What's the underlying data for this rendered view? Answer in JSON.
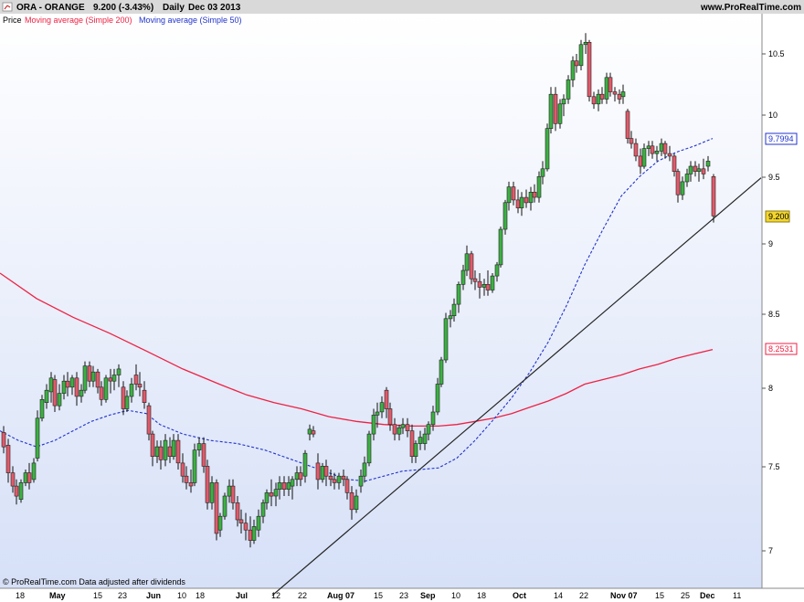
{
  "header": {
    "symbol": "ORA - ORANGE",
    "quote": "9.200 (-3.43%)",
    "period": "Daily",
    "date": "Dec 03 2013",
    "site": "www.ProRealTime.com",
    "legend_price": "Price",
    "legend_ma200": "Moving average (Simple 200)",
    "legend_ma50": "Moving average (Simple 50)"
  },
  "footer": {
    "note": "© ProRealTime.com  Data adjusted after dividends"
  },
  "colors": {
    "up": "#3cb043",
    "down": "#e05a6a",
    "ma200": "#ee2244",
    "ma50": "#2233cc",
    "trendline": "#222222",
    "bg_top": "#ffffff",
    "bg_bottom": "#d6e0f7"
  },
  "chart_data": {
    "type": "candlestick",
    "title": "ORA - ORANGE",
    "scale": "log",
    "ylim": [
      6.75,
      10.85
    ],
    "y_ticks": [
      "10.5",
      "10",
      "9.5",
      "9",
      "8.5",
      "8",
      "7.5",
      "7"
    ],
    "x_ticks": [
      "18",
      "May",
      "15",
      "23",
      "Jun",
      "10",
      "18",
      "Jul",
      "12",
      "22",
      "Aug 07",
      "15",
      "23",
      "Sep",
      "10",
      "18",
      "Oct",
      "14",
      "22",
      "Nov 07",
      "15",
      "25",
      "Dec",
      "11"
    ],
    "last_values": {
      "ma50": "9.7994",
      "price": "9.200",
      "ma200": "8.2531"
    },
    "series": [
      {
        "name": "Moving average (Simple 200)",
        "style": "solid",
        "points": [
          [
            0,
            8.78
          ],
          [
            40,
            8.6
          ],
          [
            80,
            8.47
          ],
          [
            120,
            8.36
          ],
          [
            160,
            8.24
          ],
          [
            200,
            8.12
          ],
          [
            240,
            8.02
          ],
          [
            270,
            7.95
          ],
          [
            300,
            7.9
          ],
          [
            330,
            7.86
          ],
          [
            360,
            7.81
          ],
          [
            390,
            7.78
          ],
          [
            420,
            7.76
          ],
          [
            450,
            7.75
          ],
          [
            480,
            7.75
          ],
          [
            500,
            7.76
          ],
          [
            520,
            7.78
          ],
          [
            540,
            7.8
          ],
          [
            560,
            7.83
          ],
          [
            580,
            7.87
          ],
          [
            600,
            7.91
          ],
          [
            620,
            7.96
          ],
          [
            640,
            8.02
          ],
          [
            660,
            8.05
          ],
          [
            680,
            8.08
          ],
          [
            700,
            8.12
          ],
          [
            720,
            8.15
          ],
          [
            740,
            8.19
          ],
          [
            760,
            8.22
          ],
          [
            780,
            8.25
          ]
        ]
      },
      {
        "name": "Moving average (Simple 50)",
        "style": "dashed",
        "points": [
          [
            0,
            7.72
          ],
          [
            20,
            7.66
          ],
          [
            40,
            7.62
          ],
          [
            60,
            7.66
          ],
          [
            80,
            7.72
          ],
          [
            100,
            7.78
          ],
          [
            120,
            7.82
          ],
          [
            140,
            7.85
          ],
          [
            160,
            7.83
          ],
          [
            175,
            7.76
          ],
          [
            200,
            7.7
          ],
          [
            230,
            7.66
          ],
          [
            260,
            7.64
          ],
          [
            290,
            7.6
          ],
          [
            320,
            7.54
          ],
          [
            350,
            7.48
          ],
          [
            380,
            7.42
          ],
          [
            400,
            7.41
          ],
          [
            420,
            7.44
          ],
          [
            440,
            7.47
          ],
          [
            460,
            7.48
          ],
          [
            480,
            7.49
          ],
          [
            500,
            7.55
          ],
          [
            520,
            7.66
          ],
          [
            540,
            7.79
          ],
          [
            560,
            7.93
          ],
          [
            580,
            8.1
          ],
          [
            600,
            8.3
          ],
          [
            620,
            8.55
          ],
          [
            640,
            8.84
          ],
          [
            660,
            9.1
          ],
          [
            680,
            9.35
          ],
          [
            700,
            9.5
          ],
          [
            720,
            9.62
          ],
          [
            740,
            9.69
          ],
          [
            760,
            9.74
          ],
          [
            780,
            9.8
          ]
        ]
      },
      {
        "name": "trendline",
        "style": "solid",
        "points": [
          [
            298,
            6.75
          ],
          [
            833,
            9.49
          ]
        ]
      }
    ],
    "candles": [
      [
        4,
        7.71,
        7.75,
        7.58,
        7.62
      ],
      [
        9,
        7.63,
        7.67,
        7.4,
        7.46
      ],
      [
        14,
        7.46,
        7.5,
        7.34,
        7.38
      ],
      [
        18,
        7.38,
        7.42,
        7.27,
        7.32
      ],
      [
        23,
        7.3,
        7.42,
        7.28,
        7.4
      ],
      [
        28,
        7.4,
        7.48,
        7.38,
        7.46
      ],
      [
        32,
        7.46,
        7.52,
        7.36,
        7.4
      ],
      [
        37,
        7.42,
        7.55,
        7.4,
        7.52
      ],
      [
        41,
        7.55,
        7.85,
        7.53,
        7.8
      ],
      [
        46,
        7.8,
        7.95,
        7.78,
        7.92
      ],
      [
        51,
        7.9,
        8.02,
        7.86,
        7.98
      ],
      [
        56,
        7.97,
        8.1,
        7.9,
        8.06
      ],
      [
        60,
        8.05,
        8.08,
        7.84,
        7.88
      ],
      [
        65,
        7.88,
        8.02,
        7.85,
        7.96
      ],
      [
        70,
        7.96,
        8.08,
        7.92,
        8.04
      ],
      [
        74,
        8.04,
        8.1,
        7.94,
        8.0
      ],
      [
        79,
        8.0,
        8.08,
        7.95,
        8.06
      ],
      [
        84,
        8.06,
        8.1,
        7.88,
        7.94
      ],
      [
        89,
        7.94,
        8.02,
        7.9,
        7.98
      ],
      [
        93,
        7.98,
        8.17,
        7.96,
        8.14
      ],
      [
        98,
        8.14,
        8.17,
        8.0,
        8.04
      ],
      [
        102,
        8.04,
        8.14,
        8.0,
        8.1
      ],
      [
        107,
        8.1,
        8.12,
        7.96,
        8.0
      ],
      [
        111,
        8.0,
        8.04,
        7.88,
        7.92
      ],
      [
        116,
        7.92,
        8.08,
        7.9,
        8.06
      ],
      [
        121,
        8.06,
        8.12,
        7.96,
        8.04
      ],
      [
        125,
        8.04,
        8.12,
        7.98,
        8.08
      ],
      [
        130,
        8.08,
        8.15,
        8.0,
        8.12
      ],
      [
        135,
        8.0,
        8.04,
        7.82,
        7.86
      ],
      [
        139,
        7.86,
        7.98,
        7.84,
        7.94
      ],
      [
        144,
        7.94,
        8.06,
        7.9,
        8.02
      ],
      [
        149,
        8.08,
        8.15,
        7.98,
        8.02
      ],
      [
        153,
        8.02,
        8.1,
        7.94,
        8.0
      ],
      [
        158,
        7.98,
        8.04,
        7.86,
        7.9
      ],
      [
        163,
        7.88,
        7.9,
        7.66,
        7.7
      ],
      [
        167,
        7.7,
        7.72,
        7.5,
        7.56
      ],
      [
        172,
        7.56,
        7.66,
        7.52,
        7.62
      ],
      [
        176,
        7.62,
        7.66,
        7.48,
        7.54
      ],
      [
        181,
        7.54,
        7.7,
        7.5,
        7.66
      ],
      [
        186,
        7.62,
        7.68,
        7.52,
        7.56
      ],
      [
        190,
        7.56,
        7.7,
        7.54,
        7.66
      ],
      [
        195,
        7.66,
        7.7,
        7.48,
        7.52
      ],
      [
        200,
        7.52,
        7.58,
        7.4,
        7.44
      ],
      [
        204,
        7.44,
        7.5,
        7.36,
        7.4
      ],
      [
        209,
        7.4,
        7.48,
        7.34,
        7.38
      ],
      [
        213,
        7.4,
        7.64,
        7.38,
        7.6
      ],
      [
        218,
        7.6,
        7.68,
        7.56,
        7.64
      ],
      [
        223,
        7.64,
        7.68,
        7.46,
        7.5
      ],
      [
        227,
        7.5,
        7.54,
        7.24,
        7.28
      ],
      [
        232,
        7.28,
        7.44,
        7.24,
        7.4
      ],
      [
        237,
        7.4,
        7.42,
        7.06,
        7.1
      ],
      [
        241,
        7.12,
        7.22,
        7.08,
        7.2
      ],
      [
        246,
        7.2,
        7.34,
        7.18,
        7.32
      ],
      [
        251,
        7.32,
        7.42,
        7.28,
        7.38
      ],
      [
        255,
        7.38,
        7.42,
        7.24,
        7.28
      ],
      [
        260,
        7.28,
        7.32,
        7.14,
        7.18
      ],
      [
        264,
        7.18,
        7.24,
        7.1,
        7.16
      ],
      [
        269,
        7.16,
        7.22,
        7.06,
        7.12
      ],
      [
        274,
        7.12,
        7.2,
        7.02,
        7.06
      ],
      [
        278,
        7.06,
        7.18,
        7.04,
        7.14
      ],
      [
        283,
        7.12,
        7.24,
        7.08,
        7.2
      ],
      [
        288,
        7.2,
        7.3,
        7.16,
        7.28
      ],
      [
        292,
        7.28,
        7.36,
        7.24,
        7.34
      ],
      [
        297,
        7.34,
        7.42,
        7.26,
        7.32
      ],
      [
        302,
        7.32,
        7.4,
        7.26,
        7.36
      ],
      [
        306,
        7.36,
        7.44,
        7.3,
        7.4
      ],
      [
        311,
        7.4,
        7.44,
        7.32,
        7.36
      ],
      [
        316,
        7.36,
        7.44,
        7.32,
        7.4
      ],
      [
        320,
        7.38,
        7.44,
        7.3,
        7.42
      ],
      [
        325,
        7.42,
        7.5,
        7.38,
        7.46
      ],
      [
        329,
        7.46,
        7.5,
        7.38,
        7.42
      ],
      [
        334,
        7.44,
        7.6,
        7.4,
        7.58
      ],
      [
        339,
        7.7,
        7.76,
        7.66,
        7.73
      ],
      [
        343,
        7.72,
        7.75,
        7.68,
        7.7
      ],
      [
        348,
        7.52,
        7.58,
        7.36,
        7.42
      ],
      [
        353,
        7.42,
        7.52,
        7.4,
        7.5
      ],
      [
        357,
        7.5,
        7.54,
        7.38,
        7.44
      ],
      [
        362,
        7.44,
        7.48,
        7.38,
        7.42
      ],
      [
        366,
        7.42,
        7.46,
        7.36,
        7.4
      ],
      [
        371,
        7.4,
        7.46,
        7.36,
        7.44
      ],
      [
        376,
        7.44,
        7.48,
        7.38,
        7.42
      ],
      [
        380,
        7.42,
        7.44,
        7.3,
        7.34
      ],
      [
        385,
        7.34,
        7.38,
        7.18,
        7.24
      ],
      [
        390,
        7.24,
        7.36,
        7.22,
        7.32
      ],
      [
        395,
        7.38,
        7.48,
        7.34,
        7.44
      ],
      [
        399,
        7.44,
        7.56,
        7.4,
        7.52
      ],
      [
        404,
        7.52,
        7.72,
        7.5,
        7.7
      ],
      [
        409,
        7.7,
        7.86,
        7.66,
        7.82
      ],
      [
        413,
        7.82,
        7.9,
        7.74,
        7.84
      ],
      [
        418,
        7.84,
        7.94,
        7.8,
        7.9
      ],
      [
        423,
        7.98,
        8.0,
        7.8,
        7.86
      ],
      [
        427,
        7.86,
        7.9,
        7.72,
        7.76
      ],
      [
        432,
        7.76,
        7.8,
        7.66,
        7.7
      ],
      [
        437,
        7.7,
        7.76,
        7.66,
        7.74
      ],
      [
        441,
        7.74,
        7.8,
        7.7,
        7.76
      ],
      [
        446,
        7.76,
        7.8,
        7.68,
        7.72
      ],
      [
        451,
        7.72,
        7.76,
        7.52,
        7.56
      ],
      [
        455,
        7.56,
        7.66,
        7.52,
        7.64
      ],
      [
        460,
        7.64,
        7.72,
        7.6,
        7.68
      ],
      [
        465,
        7.64,
        7.74,
        7.6,
        7.7
      ],
      [
        469,
        7.7,
        7.78,
        7.66,
        7.76
      ],
      [
        474,
        7.76,
        7.88,
        7.72,
        7.84
      ],
      [
        479,
        7.84,
        8.06,
        7.82,
        8.02
      ],
      [
        483,
        8.02,
        8.2,
        8.0,
        8.18
      ],
      [
        488,
        8.18,
        8.5,
        8.16,
        8.46
      ],
      [
        493,
        8.46,
        8.52,
        8.4,
        8.48
      ],
      [
        497,
        8.48,
        8.6,
        8.44,
        8.56
      ],
      [
        502,
        8.56,
        8.72,
        8.5,
        8.7
      ],
      [
        507,
        8.7,
        8.84,
        8.66,
        8.8
      ],
      [
        511,
        8.8,
        8.98,
        8.76,
        8.92
      ],
      [
        516,
        8.92,
        8.94,
        8.7,
        8.74
      ],
      [
        520,
        8.74,
        8.8,
        8.66,
        8.72
      ],
      [
        525,
        8.72,
        8.78,
        8.6,
        8.68
      ],
      [
        530,
        8.68,
        8.74,
        8.62,
        8.7
      ],
      [
        534,
        8.7,
        8.8,
        8.62,
        8.66
      ],
      [
        539,
        8.66,
        8.78,
        8.64,
        8.76
      ],
      [
        544,
        8.76,
        8.86,
        8.72,
        8.84
      ],
      [
        548,
        8.84,
        9.12,
        8.82,
        9.1
      ],
      [
        553,
        9.1,
        9.32,
        9.06,
        9.3
      ],
      [
        557,
        9.3,
        9.46,
        9.24,
        9.42
      ],
      [
        562,
        9.42,
        9.46,
        9.28,
        9.32
      ],
      [
        567,
        9.32,
        9.4,
        9.22,
        9.26
      ],
      [
        571,
        9.26,
        9.38,
        9.2,
        9.34
      ],
      [
        576,
        9.34,
        9.4,
        9.26,
        9.3
      ],
      [
        581,
        9.3,
        9.42,
        9.24,
        9.38
      ],
      [
        585,
        9.38,
        9.44,
        9.3,
        9.34
      ],
      [
        590,
        9.34,
        9.54,
        9.3,
        9.5
      ],
      [
        594,
        9.5,
        9.62,
        9.44,
        9.56
      ],
      [
        599,
        9.56,
        9.92,
        9.54,
        9.88
      ],
      [
        603,
        9.88,
        10.22,
        9.84,
        10.16
      ],
      [
        608,
        10.16,
        10.22,
        9.86,
        9.92
      ],
      [
        613,
        9.92,
        10.12,
        9.88,
        10.08
      ],
      [
        617,
        10.08,
        10.16,
        9.98,
        10.12
      ],
      [
        622,
        10.12,
        10.32,
        10.08,
        10.28
      ],
      [
        627,
        10.28,
        10.48,
        10.22,
        10.44
      ],
      [
        631,
        10.44,
        10.5,
        10.34,
        10.4
      ],
      [
        636,
        10.4,
        10.62,
        10.36,
        10.58
      ],
      [
        641,
        10.58,
        10.68,
        10.5,
        10.6
      ],
      [
        645,
        10.6,
        10.62,
        10.1,
        10.14
      ],
      [
        650,
        10.14,
        10.18,
        10.04,
        10.08
      ],
      [
        655,
        10.08,
        10.2,
        10.02,
        10.16
      ],
      [
        659,
        10.16,
        10.22,
        10.08,
        10.12
      ],
      [
        664,
        10.12,
        10.34,
        10.08,
        10.3
      ],
      [
        668,
        10.3,
        10.34,
        10.14,
        10.18
      ],
      [
        673,
        10.18,
        10.22,
        10.1,
        10.16
      ],
      [
        678,
        10.16,
        10.2,
        10.08,
        10.12
      ],
      [
        682,
        10.14,
        10.24,
        10.08,
        10.18
      ],
      [
        687,
        10.02,
        10.04,
        9.76,
        9.8
      ],
      [
        691,
        9.8,
        9.86,
        9.72,
        9.76
      ],
      [
        696,
        9.76,
        9.8,
        9.62,
        9.66
      ],
      [
        701,
        9.66,
        9.72,
        9.52,
        9.58
      ],
      [
        705,
        9.58,
        9.76,
        9.56,
        9.72
      ],
      [
        710,
        9.72,
        9.78,
        9.66,
        9.74
      ],
      [
        714,
        9.74,
        9.78,
        9.64,
        9.68
      ],
      [
        719,
        9.68,
        9.74,
        9.62,
        9.7
      ],
      [
        724,
        9.7,
        9.8,
        9.66,
        9.76
      ],
      [
        728,
        9.76,
        9.78,
        9.64,
        9.68
      ],
      [
        733,
        9.68,
        9.74,
        9.62,
        9.66
      ],
      [
        738,
        9.66,
        9.68,
        9.5,
        9.54
      ],
      [
        742,
        9.54,
        9.56,
        9.3,
        9.36
      ],
      [
        747,
        9.36,
        9.5,
        9.32,
        9.46
      ],
      [
        752,
        9.46,
        9.56,
        9.42,
        9.52
      ],
      [
        756,
        9.52,
        9.62,
        9.46,
        9.58
      ],
      [
        761,
        9.58,
        9.62,
        9.5,
        9.54
      ],
      [
        765,
        9.54,
        9.6,
        9.46,
        9.56
      ],
      [
        770,
        9.56,
        9.64,
        9.48,
        9.52
      ],
      [
        775,
        9.58,
        9.66,
        9.54,
        9.62
      ],
      [
        781,
        9.5,
        9.52,
        9.15,
        9.2
      ]
    ]
  }
}
